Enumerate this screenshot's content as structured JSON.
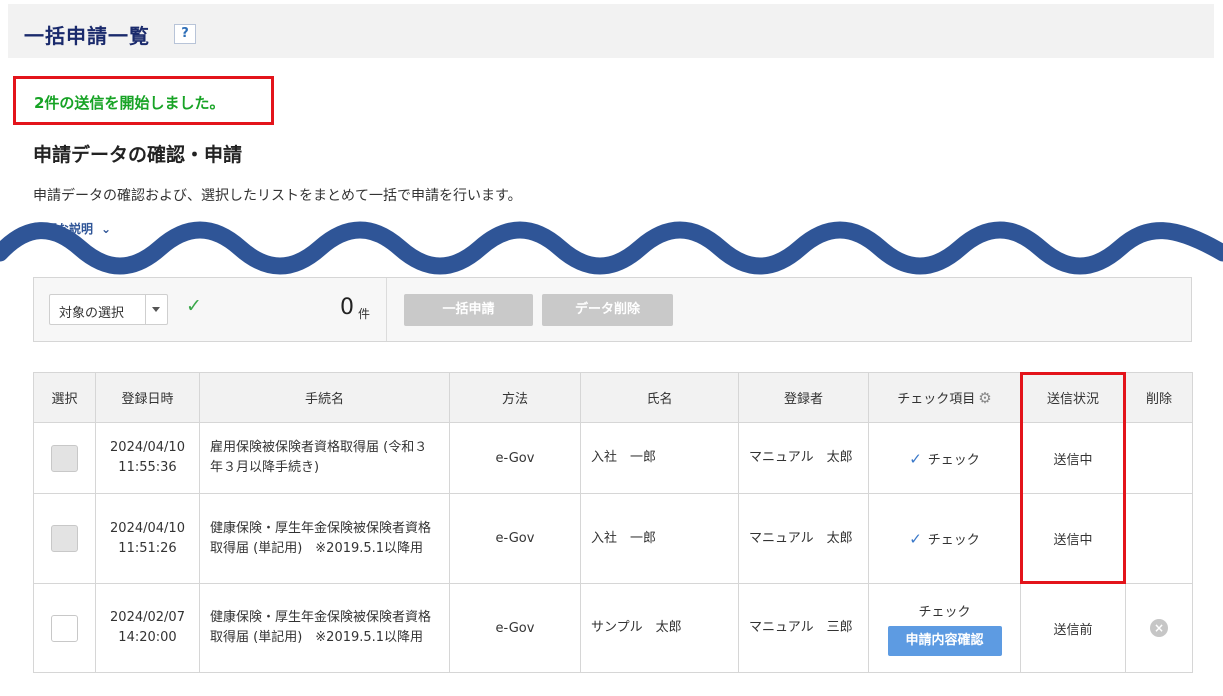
{
  "header": {
    "title": "一括申請一覧",
    "help": "?"
  },
  "alert": {
    "message": "2件の送信を開始しました。"
  },
  "section": {
    "title": "申請データの確認・申請",
    "description": "申請データの確認および、選択したリストをまとめて一括で申請を行います。",
    "detail_link": "詳細な説明"
  },
  "toolbar": {
    "select_label": "対象の選択",
    "count": "0",
    "count_unit": "件",
    "bulk_button": "一括申請",
    "delete_button": "データ削除"
  },
  "table": {
    "headers": [
      "選択",
      "登録日時",
      "手続名",
      "方法",
      "氏名",
      "登録者",
      "チェック項目",
      "送信状況",
      "削除"
    ],
    "rows": [
      {
        "date": "2024/04/10",
        "time": "11:55:36",
        "procedure": "雇用保険被保険者資格取得届 (令和３年３月以降手続き)",
        "method": "e-Gov",
        "name": "入社　一郎",
        "registrant": "マニュアル　太郎",
        "check": "チェック",
        "status": "送信中"
      },
      {
        "date": "2024/04/10",
        "time": "11:51:26",
        "procedure": "健康保険・厚生年金保険被保険者資格取得届 (単記用)　※2019.5.1以降用",
        "method": "e-Gov",
        "name": "入社　一郎",
        "registrant": "マニュアル　太郎",
        "check": "チェック",
        "status": "送信中"
      },
      {
        "date": "2024/02/07",
        "time": "14:20:00",
        "procedure": "健康保険・厚生年金保険被保険者資格取得届 (単記用)　※2019.5.1以降用",
        "method": "e-Gov",
        "name": "サンプル　太郎",
        "registrant": "マニュアル　三郎",
        "check": "チェック",
        "confirm_button": "申請内容確認",
        "status": "送信前"
      }
    ]
  },
  "colors": {
    "title": "#1a2a6c",
    "success": "#17a325",
    "highlight": "#e3141b",
    "wave": "#2f5597",
    "primary_button": "#5d9be2"
  }
}
